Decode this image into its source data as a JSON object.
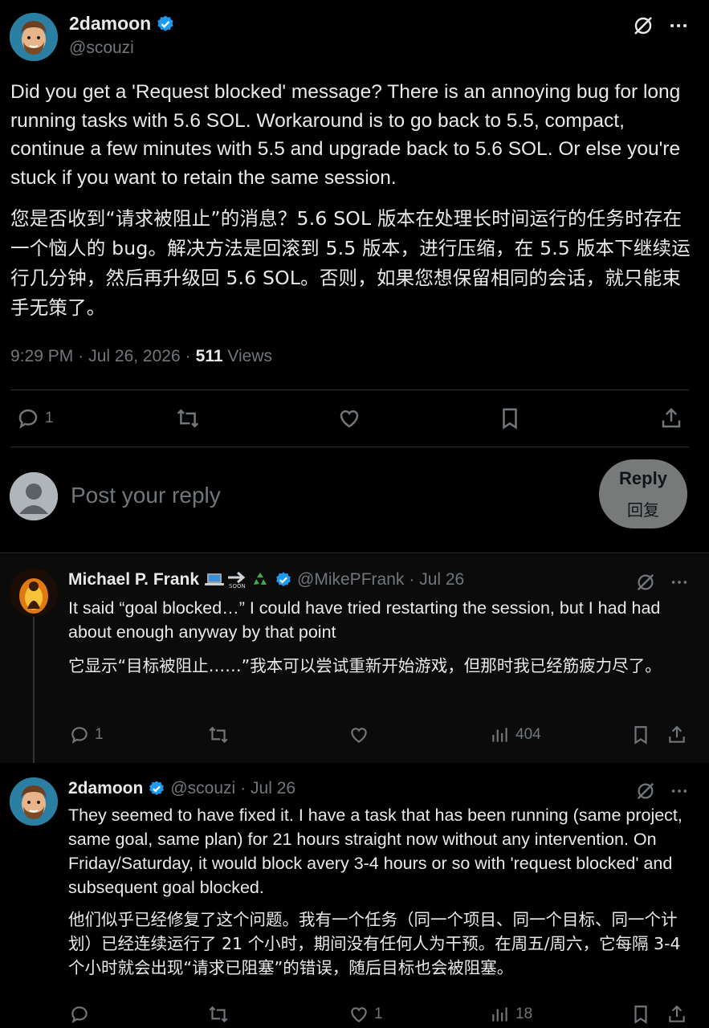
{
  "main_tweet": {
    "author_name": "2damoon",
    "handle": "@scouzi",
    "text_en": "Did you get a 'Request blocked' message? There is an annoying bug for long running tasks with 5.6 SOL. Workaround is to go back to 5.5, compact, continue a few minutes with 5.5 and upgrade back to 5.6 SOL. Or else you're stuck if you want to retain the same session.",
    "text_zh": "您是否收到“请求被阻止”的消息？5.6 SOL 版本在处理长时间运行的任务时存在一个恼人的 bug。解决方法是回滚到 5.5 版本，进行压缩，在 5.5 版本下继续运行几分钟，然后再升级回 5.6 SOL。否则，如果您想保留相同的会话，就只能束手无策了。",
    "time": "9:29 PM",
    "date": "Jul 26, 2026",
    "views_count": "511",
    "views_label": "Views",
    "reply_count": "1",
    "sep": "·"
  },
  "compose": {
    "placeholder": "Post your reply",
    "button_en": "Reply",
    "button_zh": "回复"
  },
  "replies": [
    {
      "author_name": "Michael P. Frank",
      "handle": "@MikePFrank",
      "date": "· Jul 26",
      "text_en": "It said “goal blocked…” I could have tried restarting the session, but I had had about enough anyway by that point",
      "text_zh": "它显示“目标被阻止……”我本可以尝试重新开始游戏，但那时我已经筋疲力尽了。",
      "reply_count": "1",
      "like_count": "",
      "views_count": "404",
      "emoji": [
        "laptop-emoji",
        "soon-arrow-emoji",
        "recycle-emoji"
      ]
    },
    {
      "author_name": "2damoon",
      "handle": "@scouzi",
      "date": "· Jul 26",
      "text_en": "They seemed to have fixed it. I have a task that has been running (same project, same goal, same plan) for 21 hours straight now without any intervention. On Friday/Saturday, it would block avery 3-4 hours or so with 'request blocked' and subsequent goal blocked.",
      "text_zh": "他们似乎已经修复了这个问题。我有一个任务（同一个项目、同一个目标、同一个计划）已经连续运行了 21 个小时，期间没有任何人为干预。在周五/周六，它每隔 3-4 个小时就会出现“请求已阻塞”的错误，随后目标也会被阻塞。",
      "reply_count": "",
      "like_count": "1",
      "views_count": "18"
    }
  ],
  "colors": {
    "background": "#000000",
    "text": "#e7e9ea",
    "muted": "#71767b",
    "verified_blue": "#1d9bf0",
    "divider": "#2f3336"
  }
}
